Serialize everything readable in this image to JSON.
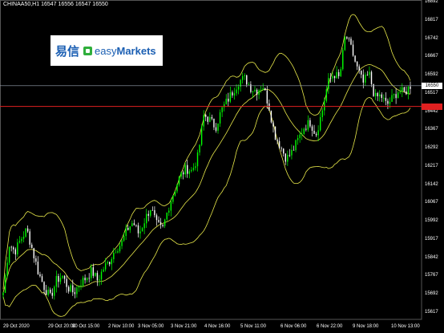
{
  "header": {
    "symbol_info": "CHINAA50,H1  16547 16556 16547 16550"
  },
  "logo": {
    "chinese": "易信",
    "english_light": "easy",
    "english_bold": "Markets"
  },
  "colors": {
    "background": "#000000",
    "bull": "#00ff00",
    "bear": "#ffffff",
    "bands": "#e8e84a",
    "bid_line": "#9aa3b3",
    "red_line": "#e02020",
    "grid": "#1e1e1e"
  },
  "current_price_label": "16550",
  "chart_data": {
    "type": "candlestick",
    "symbol": "CHINAA50",
    "timeframe": "H1",
    "ohlc_header": [
      16547,
      16556,
      16547,
      16550
    ],
    "y_ticks": [
      "16892",
      "16817",
      "16742",
      "16667",
      "16592",
      "16517",
      "16442",
      "16367",
      "16292",
      "16217",
      "16142",
      "16067",
      "15992",
      "15917",
      "15842",
      "15767",
      "15692",
      "15617"
    ],
    "ylim": [
      15600,
      16900
    ],
    "x_ticks": [
      "29 Oct 2020",
      "29 Oct 20:00",
      "30 Oct 15:00",
      "2 Nov 10:00",
      "3 Nov 05:00",
      "3 Nov 21:00",
      "4 Nov 16:00",
      "5 Nov 11:00",
      "6 Nov 06:00",
      "6 Nov 22:00",
      "9 Nov 18:00",
      "10 Nov 13:00"
    ],
    "bid_price": 16550,
    "red_level": 16465,
    "indicator": "Bollinger Bands",
    "close_path": [
      15700,
      15900,
      15870,
      15920,
      15960,
      15870,
      15780,
      15720,
      15680,
      15750,
      15770,
      15720,
      15700,
      15740,
      15760,
      15790,
      15750,
      15800,
      15830,
      15880,
      15900,
      15960,
      15990,
      15940,
      16000,
      16050,
      15980,
      15960,
      16050,
      16120,
      16180,
      16210,
      16200,
      16260,
      16430,
      16410,
      16380,
      16450,
      16490,
      16530,
      16570,
      16580,
      16540,
      16530,
      16550,
      16470,
      16350,
      16300,
      16250,
      16280,
      16330,
      16380,
      16400,
      16350,
      16440,
      16560,
      16600,
      16580,
      16760,
      16700,
      16620,
      16560,
      16600,
      16500,
      16510,
      16470,
      16500,
      16530,
      16520,
      16550
    ]
  }
}
